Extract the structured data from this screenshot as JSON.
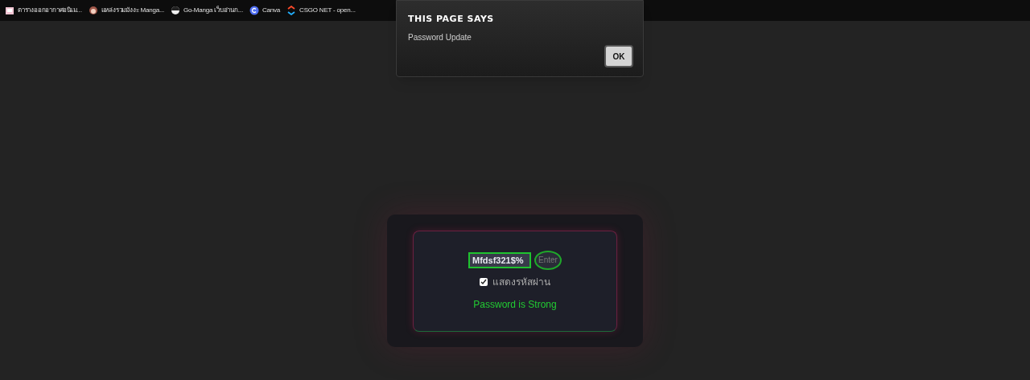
{
  "bookmarks": [
    {
      "label": "ตารางออกอากาศอนิเม...",
      "kind": "anime"
    },
    {
      "label": "แหล่งรวมมังงะ Manga...",
      "kind": "manga"
    },
    {
      "label": "Go-Manga เว็บอ่านก...",
      "kind": "gomanga"
    },
    {
      "label": "Canva",
      "kind": "canva"
    },
    {
      "label": "CSGO NET - open...",
      "kind": "csgo"
    }
  ],
  "dialog": {
    "title": "THIS PAGE SAYS",
    "message": "Password Update",
    "button": "OK"
  },
  "form": {
    "password": "Mfdsf321$%",
    "button": "Enter",
    "show_password": {
      "label": "แสดงรหัสผ่าน",
      "checked": true
    },
    "status": "Password is Strong"
  }
}
